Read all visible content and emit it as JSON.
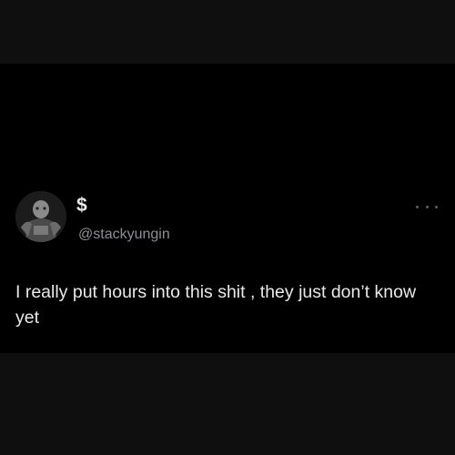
{
  "tweet": {
    "display_name": "$",
    "handle": "@stackyungin",
    "text": "I really put hours into this shit , they just don’t know yet",
    "avatar_icon": "profile-photo-icon",
    "more_icon": "more-options-icon"
  },
  "colors": {
    "background": "#0f0f0f",
    "post_background": "#000000",
    "primary_text": "#e7e9ea",
    "secondary_text": "#8b8f94"
  }
}
